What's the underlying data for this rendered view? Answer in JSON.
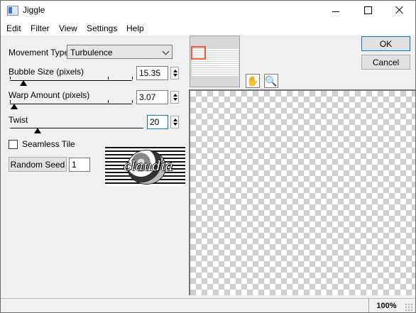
{
  "window": {
    "title": "Jiggle"
  },
  "menu": [
    "Edit",
    "Filter",
    "View",
    "Settings",
    "Help"
  ],
  "movement_type": {
    "label": "Movement Type:",
    "value": "Turbulence"
  },
  "controls": {
    "bubble_size": {
      "label": "Bubble Size (pixels)",
      "value": "15.35",
      "level": 0.1
    },
    "warp_amount": {
      "label": "Warp Amount (pixels)",
      "value": "3.07",
      "level": 0.02
    },
    "twist": {
      "label": "Twist",
      "value": "20",
      "level": 0.2
    }
  },
  "seamless_tile": {
    "label": "Seamless Tile",
    "checked": false
  },
  "random_seed": {
    "label": "Random Seed",
    "value": "1"
  },
  "buttons": {
    "ok": "OK",
    "cancel": "Cancel"
  },
  "tools": {
    "pan": "hand-icon",
    "zoom": "magnifier-icon"
  },
  "logo": {
    "text": "claudia"
  },
  "status": {
    "zoom": "100%"
  },
  "colors": {
    "focus": "#0078d7",
    "selection": "#f05a3a"
  }
}
